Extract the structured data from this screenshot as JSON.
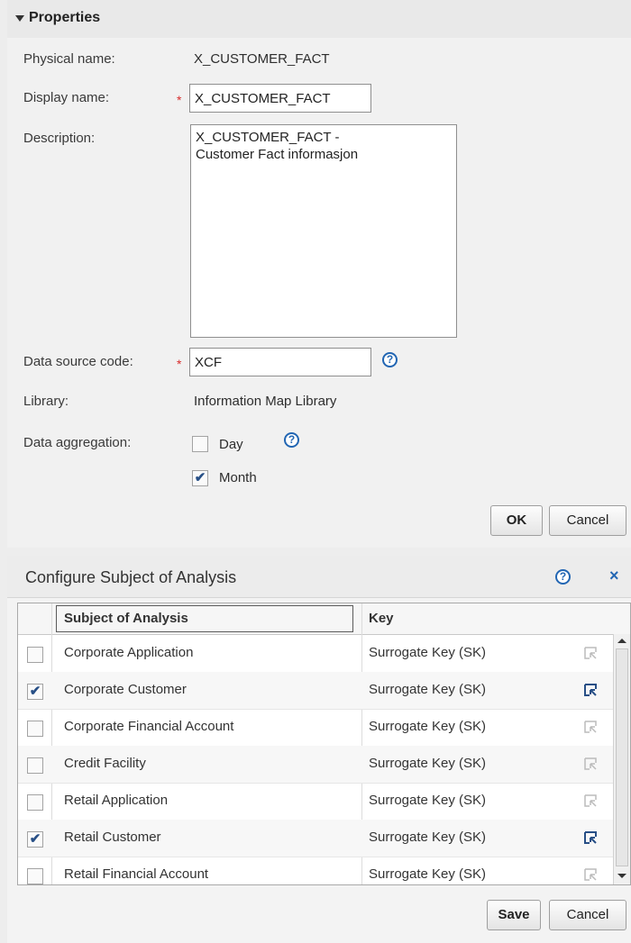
{
  "properties": {
    "title": "Properties",
    "physical_name_label": "Physical name:",
    "physical_name_value": "X_CUSTOMER_FACT",
    "display_name_label": "Display name:",
    "display_name_value": "X_CUSTOMER_FACT",
    "description_label": "Description:",
    "description_value": "X_CUSTOMER_FACT -\nCustomer Fact informasjon",
    "data_source_code_label": "Data source code:",
    "data_source_code_value": "XCF",
    "library_label": "Library:",
    "library_value": "Information Map Library",
    "data_aggregation_label": "Data aggregation:",
    "aggregation_options": [
      {
        "label": "Day",
        "checked": false
      },
      {
        "label": "Month",
        "checked": true
      }
    ],
    "required_marker": "*",
    "help_glyph": "?",
    "ok_label": "OK",
    "cancel_label": "Cancel"
  },
  "dialog": {
    "title": "Configure Subject of Analysis",
    "help_glyph": "?",
    "close_glyph": "×",
    "columns": [
      "Subject of Analysis",
      "Key"
    ],
    "rows": [
      {
        "subject": "Corporate Application",
        "key": "Surrogate Key (SK)",
        "checked": false
      },
      {
        "subject": "Corporate Customer",
        "key": "Surrogate Key (SK)",
        "checked": true
      },
      {
        "subject": "Corporate Financial Account",
        "key": "Surrogate Key (SK)",
        "checked": false
      },
      {
        "subject": "Credit Facility",
        "key": "Surrogate Key (SK)",
        "checked": false
      },
      {
        "subject": "Retail Application",
        "key": "Surrogate Key (SK)",
        "checked": false
      },
      {
        "subject": "Retail Customer",
        "key": "Surrogate Key (SK)",
        "checked": true
      },
      {
        "subject": "Retail Financial Account",
        "key": "Surrogate Key (SK)",
        "checked": false
      }
    ],
    "save_label": "Save",
    "cancel_label": "Cancel"
  },
  "colors": {
    "accent": "#2266b3",
    "required": "#d72b2b",
    "check": "#274f86"
  },
  "icons": {
    "collapse": "triangle-down-icon",
    "help": "help-circle-icon",
    "close": "close-icon",
    "key_select": "select-key-icon"
  }
}
